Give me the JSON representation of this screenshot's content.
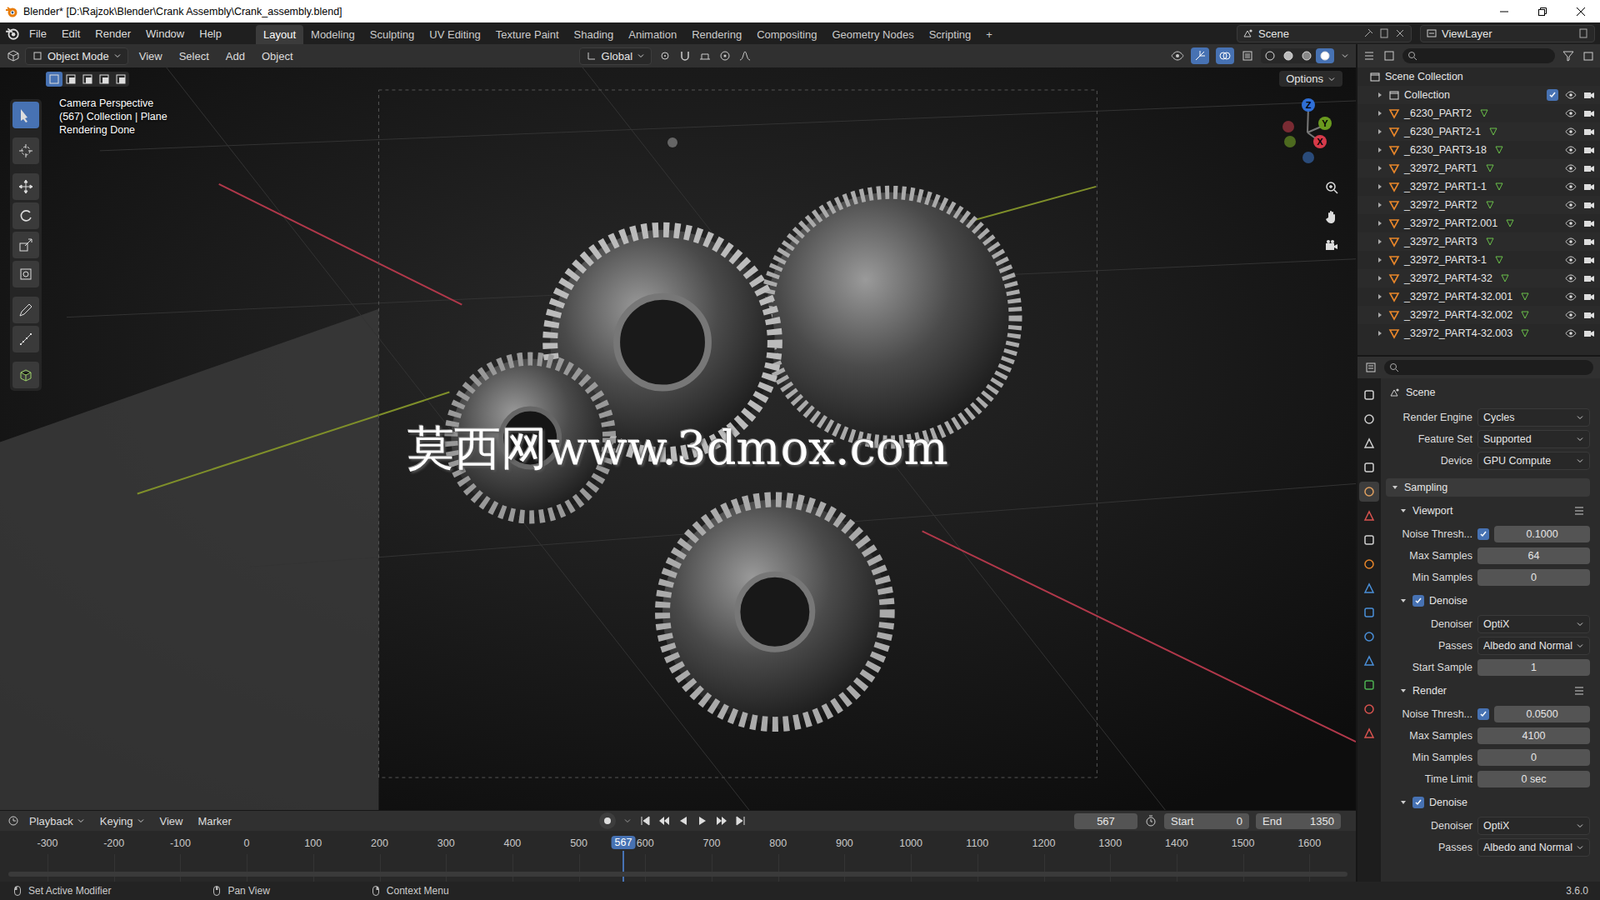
{
  "window": {
    "title": "Blender* [D:\\Rajzok\\Blender\\Crank Assembly\\Crank_assembly.blend]"
  },
  "menus": [
    "File",
    "Edit",
    "Render",
    "Window",
    "Help"
  ],
  "workspaces": [
    {
      "label": "Layout",
      "selected": true
    },
    {
      "label": "Modeling",
      "selected": false
    },
    {
      "label": "Sculpting",
      "selected": false
    },
    {
      "label": "UV Editing",
      "selected": false
    },
    {
      "label": "Texture Paint",
      "selected": false
    },
    {
      "label": "Shading",
      "selected": false
    },
    {
      "label": "Animation",
      "selected": false
    },
    {
      "label": "Rendering",
      "selected": false
    },
    {
      "label": "Compositing",
      "selected": false
    },
    {
      "label": "Geometry Nodes",
      "selected": false
    },
    {
      "label": "Scripting",
      "selected": false
    }
  ],
  "add_workspace": "+",
  "scene": "Scene",
  "view_layer": "ViewLayer",
  "viewport_header": {
    "mode": "Object Mode",
    "menus": [
      "View",
      "Select",
      "Add",
      "Object"
    ],
    "orientation": "Global",
    "options": "Options",
    "shading_modes": [
      {
        "selected": false
      },
      {
        "selected": false
      },
      {
        "selected": false
      },
      {
        "selected": true
      }
    ]
  },
  "select_modes": [
    {
      "selected": true
    },
    {
      "selected": false
    },
    {
      "selected": false
    },
    {
      "selected": false
    },
    {
      "selected": false
    }
  ],
  "tools": [
    {
      "selected": true
    },
    {
      "selected": false
    },
    {
      "selected": false
    },
    {
      "selected": false
    },
    {
      "selected": false
    },
    {
      "selected": false
    },
    {
      "selected": false
    },
    {
      "selected": false
    },
    {
      "selected": false
    }
  ],
  "viewport": {
    "info": [
      "Camera Perspective",
      "(567) Collection | Plane",
      "Rendering Done"
    ],
    "gizmo": [
      {
        "label": "Z",
        "color": "#2f6fd6"
      },
      {
        "label": "Y",
        "color": "#6a9a1f"
      },
      {
        "label": "X",
        "color": "#d63a4a"
      }
    ],
    "watermark": "莫西网www.3dmox.com"
  },
  "outliner": {
    "root": "Scene Collection",
    "items": [
      {
        "name": "Collection",
        "kind": "collection",
        "included": true,
        "visible": true,
        "renderable": true
      },
      {
        "name": "_6230_PART2",
        "kind": "object",
        "visible": true,
        "renderable": true
      },
      {
        "name": "_6230_PART2-1",
        "kind": "object",
        "visible": true,
        "renderable": true
      },
      {
        "name": "_6230_PART3-18",
        "kind": "object",
        "visible": true,
        "renderable": true
      },
      {
        "name": "_32972_PART1",
        "kind": "object",
        "visible": true,
        "renderable": true
      },
      {
        "name": "_32972_PART1-1",
        "kind": "object",
        "visible": true,
        "renderable": true
      },
      {
        "name": "_32972_PART2",
        "kind": "object",
        "visible": true,
        "renderable": true
      },
      {
        "name": "_32972_PART2.001",
        "kind": "object",
        "visible": true,
        "renderable": true
      },
      {
        "name": "_32972_PART3",
        "kind": "object",
        "visible": true,
        "renderable": true
      },
      {
        "name": "_32972_PART3-1",
        "kind": "object",
        "visible": true,
        "renderable": true
      },
      {
        "name": "_32972_PART4-32",
        "kind": "object",
        "visible": true,
        "renderable": true
      },
      {
        "name": "_32972_PART4-32.001",
        "kind": "object",
        "visible": true,
        "renderable": true
      },
      {
        "name": "_32972_PART4-32.002",
        "kind": "object",
        "visible": true,
        "renderable": true
      },
      {
        "name": "_32972_PART4-32.003",
        "kind": "object",
        "visible": true,
        "renderable": true
      }
    ]
  },
  "property_tabs": [
    {
      "selected": false
    },
    {
      "selected": false
    },
    {
      "selected": false
    },
    {
      "selected": false
    },
    {
      "selected": true
    },
    {
      "selected": false
    },
    {
      "selected": false
    },
    {
      "selected": false
    },
    {
      "selected": false
    },
    {
      "selected": false
    },
    {
      "selected": false
    },
    {
      "selected": false
    },
    {
      "selected": false
    },
    {
      "selected": false
    },
    {
      "selected": false
    }
  ],
  "properties": {
    "context": "Scene",
    "fields": [
      {
        "label": "Render Engine",
        "value": "Cycles"
      },
      {
        "label": "Feature Set",
        "value": "Supported"
      },
      {
        "label": "Device",
        "value": "GPU Compute"
      }
    ],
    "sampling": {
      "title": "Sampling",
      "expanded": true,
      "sections": [
        {
          "title": "Viewport",
          "expanded": true,
          "rows": [
            {
              "kind": "check-number",
              "label": "Noise Thresh...",
              "checked": true,
              "value": "0.1000"
            },
            {
              "kind": "number",
              "label": "Max Samples",
              "value": "64"
            },
            {
              "kind": "number",
              "label": "Min Samples",
              "value": "0"
            },
            {
              "kind": "panel",
              "label": "Denoise",
              "checked": true,
              "expanded": true
            },
            {
              "kind": "dropdown",
              "label": "Denoiser",
              "value": "OptiX"
            },
            {
              "kind": "dropdown",
              "label": "Passes",
              "value": "Albedo and Normal"
            },
            {
              "kind": "number",
              "label": "Start Sample",
              "value": "1"
            }
          ]
        },
        {
          "title": "Render",
          "expanded": true,
          "rows": [
            {
              "kind": "check-number",
              "label": "Noise Thresh...",
              "checked": true,
              "value": "0.0500"
            },
            {
              "kind": "number",
              "label": "Max Samples",
              "value": "4100"
            },
            {
              "kind": "number",
              "label": "Min Samples",
              "value": "0"
            },
            {
              "kind": "number",
              "label": "Time Limit",
              "value": "0 sec"
            },
            {
              "kind": "panel",
              "label": "Denoise",
              "checked": true,
              "expanded": true
            },
            {
              "kind": "dropdown",
              "label": "Denoiser",
              "value": "OptiX"
            },
            {
              "kind": "dropdown",
              "label": "Passes",
              "value": "Albedo and Normal"
            }
          ]
        }
      ]
    }
  },
  "timeline": {
    "menus": [
      {
        "label": "Playback",
        "dropdown": true
      },
      {
        "label": "Keying",
        "dropdown": true
      },
      {
        "label": "View",
        "dropdown": false
      },
      {
        "label": "Marker",
        "dropdown": false
      }
    ],
    "frame": "567",
    "start_label": "Start",
    "start": "0",
    "end_label": "End",
    "end": "1350",
    "ticks": [
      "-300",
      "-200",
      "-100",
      "0",
      "100",
      "200",
      "300",
      "400",
      "500",
      "600",
      "700",
      "800",
      "900",
      "1000",
      "1100",
      "1200",
      "1300",
      "1400",
      "1500",
      "1600"
    ],
    "playhead": "567"
  },
  "status_bar": {
    "hints": [
      "Set Active Modifier",
      "Pan View",
      "Context Menu"
    ],
    "version": "3.6.0"
  }
}
